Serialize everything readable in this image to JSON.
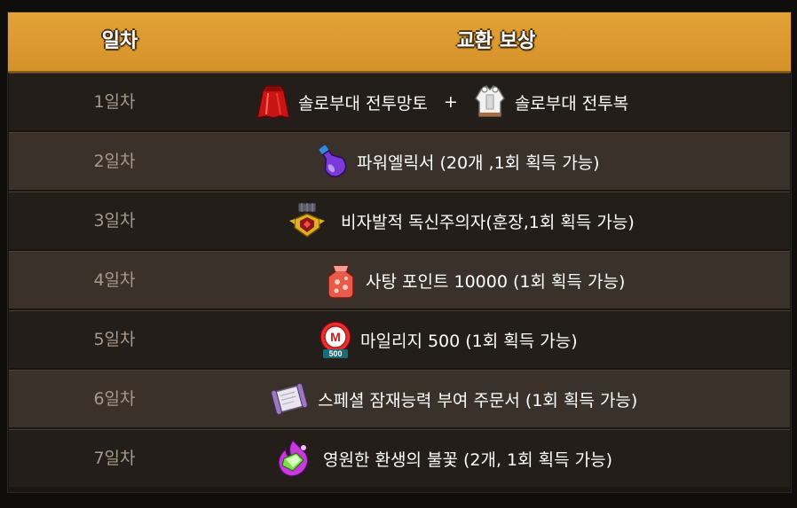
{
  "header": {
    "day": "일차",
    "reward": "교환 보상"
  },
  "rows": [
    {
      "day": "1일차",
      "reward": "솔로부대 전투망토",
      "plus": "+",
      "reward2": "솔로부대 전투복",
      "icon": "red-cape-icon",
      "icon2": "white-armor-icon"
    },
    {
      "day": "2일차",
      "reward": "파워엘릭서 (20개 ,1회 획득 가능)",
      "icon": "purple-potion-icon"
    },
    {
      "day": "3일차",
      "reward": "비자발적 독신주의자(훈장,1회 획득 가능)",
      "icon": "medal-icon"
    },
    {
      "day": "4일차",
      "reward": "사탕 포인트 10000 (1회 획득 가능)",
      "icon": "candy-pouch-icon"
    },
    {
      "day": "5일차",
      "reward": "마일리지 500 (1회 획득 가능)",
      "icon": "mileage-coin-icon",
      "icon_label": "500",
      "icon_letter": "M"
    },
    {
      "day": "6일차",
      "reward": "스페셜 잠재능력 부여 주문서 (1회 획득 가능)",
      "icon": "scroll-icon"
    },
    {
      "day": "7일차",
      "reward": "영원한 환생의 불꽃 (2개, 1회 획득 가능)",
      "icon": "rebirth-flame-icon"
    }
  ],
  "colors": {
    "header": "#e3a236",
    "row_dark": "#231e19",
    "row_light": "#3a322a",
    "day_text": "#a7988a",
    "reward_text": "#ffffff"
  }
}
